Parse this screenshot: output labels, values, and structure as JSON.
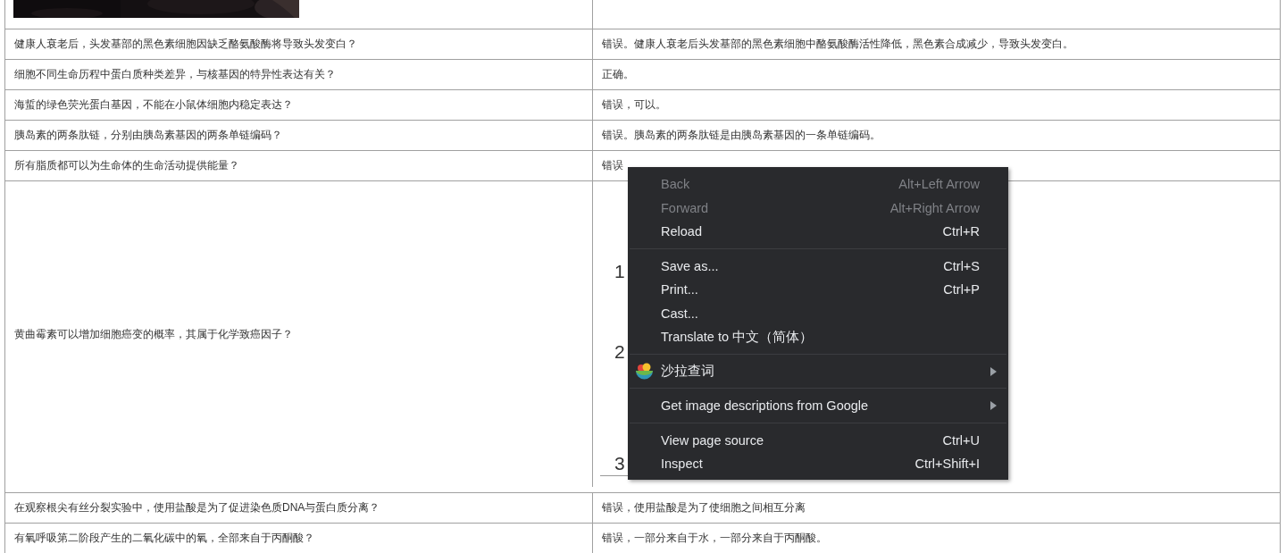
{
  "rows": [
    {
      "kind": "text",
      "question": "健康人衰老后，头发基部的黑色素细胞因缺乏酪氨酸酶将导致头发变白？",
      "answer": "错误。健康人衰老后头发基部的黑色素细胞中酪氨酸酶活性降低，黑色素合成减少，导致头发变白。"
    },
    {
      "kind": "text",
      "question": "细胞不同生命历程中蛋白质种类差异，与核基因的特异性表达有关？",
      "answer": "正确。"
    },
    {
      "kind": "text",
      "question": "海蜇的绿色荧光蛋白基因，不能在小鼠体细胞内稳定表达？",
      "answer": "错误，可以。"
    },
    {
      "kind": "text",
      "question": "胰岛素的两条肽链，分别由胰岛素基因的两条单链编码？",
      "answer": "错误。胰岛素的两条肽链是由胰岛素基因的一条单链编码。"
    },
    {
      "kind": "text",
      "question": "所有脂质都可以为生命体的生命活动提供能量？",
      "answer": "错误"
    },
    {
      "question": "黄曲霉素可以增加细胞癌变的概率，其属于化学致癌因子？",
      "answer_image": {
        "paragraphs": [
          [
            "1"
          ],
          [
            "2"
          ],
          [
            "3"
          ]
        ]
      }
    },
    {
      "kind": "text",
      "question": "在观察根尖有丝分裂实验中，使用盐酸是为了促进染色质DNA与蛋白质分离？",
      "answer": "错误，使用盐酸是为了使细胞之间相互分离"
    },
    {
      "kind": "text",
      "question": "有氧呼吸第二阶段产生的二氧化碳中的氧，全部来自于丙酮酸？",
      "answer": "错误，一部分来自于水，一部分来自于丙酮酸。"
    }
  ],
  "context_menu": {
    "sections": [
      [
        {
          "kind": "item",
          "label": "Back",
          "shortcut": "Alt+Left Arrow",
          "disabled": true,
          "submenu": false
        },
        {
          "kind": "item",
          "label": "Forward",
          "shortcut": "Alt+Right Arrow",
          "disabled": true,
          "submenu": false
        },
        {
          "kind": "item",
          "label": "Reload",
          "shortcut": "Ctrl+R",
          "disabled": false,
          "submenu": false
        }
      ],
      [
        {
          "kind": "item",
          "label": "Save as...",
          "shortcut": "Ctrl+S",
          "disabled": false,
          "submenu": false
        },
        {
          "kind": "item",
          "label": "Print...",
          "shortcut": "Ctrl+P",
          "disabled": false,
          "submenu": false
        },
        {
          "kind": "item",
          "label": "Cast...",
          "disabled": false,
          "submenu": false
        },
        {
          "kind": "item",
          "label": "Translate to 中文（简体）",
          "disabled": false,
          "submenu": false
        }
      ],
      [
        {
          "kind": "extension",
          "label": "沙拉查词",
          "disabled": false,
          "submenu": true
        }
      ],
      [
        {
          "kind": "item",
          "label": "Get image descriptions from Google",
          "disabled": false,
          "submenu": true
        }
      ],
      [
        {
          "kind": "item",
          "label": "View page source",
          "shortcut": "Ctrl+U",
          "disabled": false,
          "submenu": false
        },
        {
          "kind": "item",
          "label": "Inspect",
          "shortcut": "Ctrl+Shift+I",
          "disabled": false,
          "submenu": false
        }
      ]
    ]
  }
}
